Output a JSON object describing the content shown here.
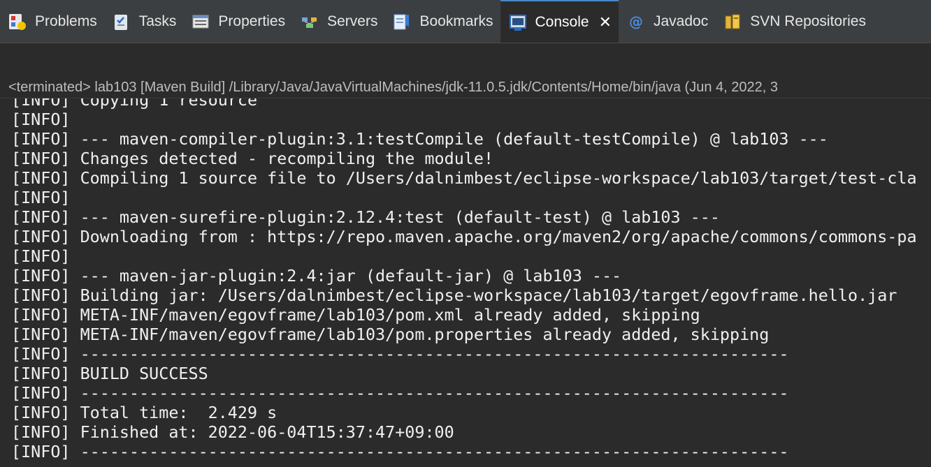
{
  "tabs": [
    {
      "label": "Problems",
      "icon": "problems-icon"
    },
    {
      "label": "Tasks",
      "icon": "tasks-icon"
    },
    {
      "label": "Properties",
      "icon": "properties-icon"
    },
    {
      "label": "Servers",
      "icon": "servers-icon"
    },
    {
      "label": "Bookmarks",
      "icon": "bookmarks-icon"
    },
    {
      "label": "Console",
      "icon": "console-icon",
      "active": true,
      "close": "✕"
    },
    {
      "label": "Javadoc",
      "icon": "javadoc-icon"
    },
    {
      "label": "SVN Repositories",
      "icon": "svn-repositories-icon"
    }
  ],
  "status": "<terminated> lab103 [Maven Build] /Library/Java/JavaVirtualMachines/jdk-11.0.5.jdk/Contents/Home/bin/java  (Jun 4, 2022, 3",
  "console_lines": [
    "[INFO] Copying 1 resource",
    "[INFO]",
    "[INFO] --- maven-compiler-plugin:3.1:testCompile (default-testCompile) @ lab103 ---",
    "[INFO] Changes detected - recompiling the module!",
    "[INFO] Compiling 1 source file to /Users/dalnimbest/eclipse-workspace/lab103/target/test-cla",
    "[INFO]",
    "[INFO] --- maven-surefire-plugin:2.12.4:test (default-test) @ lab103 ---",
    "[INFO] Downloading from : https://repo.maven.apache.org/maven2/org/apache/commons/commons-pa",
    "[INFO]",
    "[INFO] --- maven-jar-plugin:2.4:jar (default-jar) @ lab103 ---",
    "[INFO] Building jar: /Users/dalnimbest/eclipse-workspace/lab103/target/egovframe.hello.jar",
    "[INFO] META-INF/maven/egovframe/lab103/pom.xml already added, skipping",
    "[INFO] META-INF/maven/egovframe/lab103/pom.properties already added, skipping",
    "[INFO] ------------------------------------------------------------------------",
    "[INFO] BUILD SUCCESS",
    "[INFO] ------------------------------------------------------------------------",
    "[INFO] Total time:  2.429 s",
    "[INFO] Finished at: 2022-06-04T15:37:47+09:00",
    "[INFO] ------------------------------------------------------------------------"
  ],
  "colors": {
    "tabbar_bg": "#3c3f41",
    "console_bg": "#2b2b2b",
    "text": "#f0f0f0"
  }
}
